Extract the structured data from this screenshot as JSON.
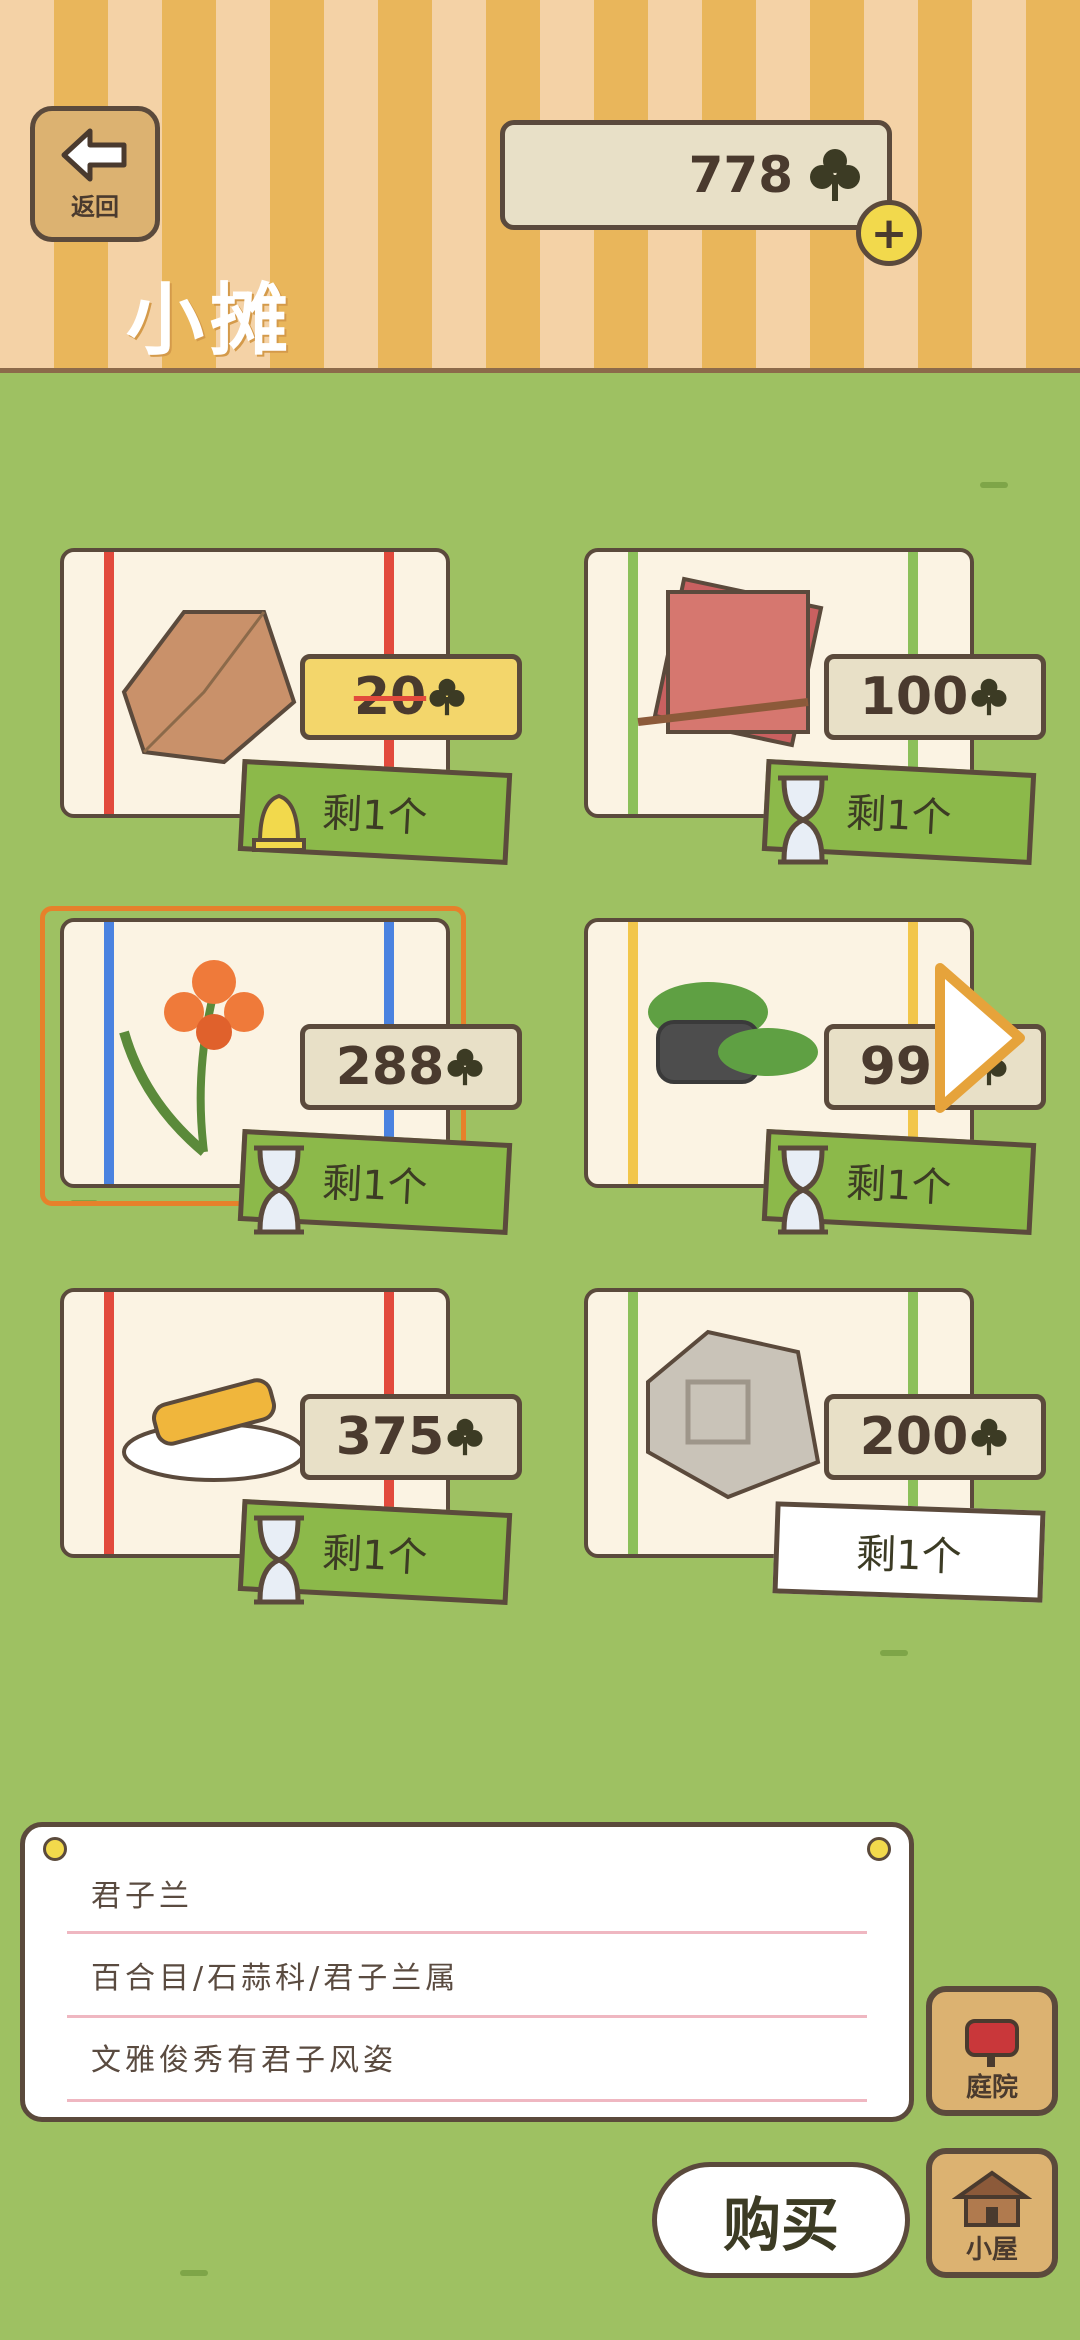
{
  "header": {
    "back_label": "返回",
    "title": "小摊",
    "clover_count": "778",
    "clover_icon": "clover-icon"
  },
  "items": [
    {
      "price": "20",
      "remain": "剩1个",
      "sale": true,
      "stripe": "#e24a3c",
      "badge": "bell-icon"
    },
    {
      "price": "100",
      "remain": "剩1个",
      "sale": false,
      "stripe": "#8cc05a",
      "badge": "hourglass-icon"
    },
    {
      "price": "288",
      "remain": "剩1个",
      "sale": false,
      "stripe": "#4a82e0",
      "badge": "hourglass-icon",
      "selected": true
    },
    {
      "price": "998",
      "remain": "剩1个",
      "sale": false,
      "stripe": "#f2c64a",
      "badge": "hourglass-icon"
    },
    {
      "price": "375",
      "remain": "剩1个",
      "sale": false,
      "stripe": "#e24a3c",
      "badge": "hourglass-icon"
    },
    {
      "price": "200",
      "remain": "剩1个",
      "sale": false,
      "stripe": "#8cc05a",
      "badge": "none"
    }
  ],
  "description": {
    "name": "君子兰",
    "category": "百合目/石蒜科/君子兰属",
    "text": "文雅俊秀有君子风姿"
  },
  "buttons": {
    "buy": "购买",
    "yard": "庭院",
    "house": "小屋"
  }
}
